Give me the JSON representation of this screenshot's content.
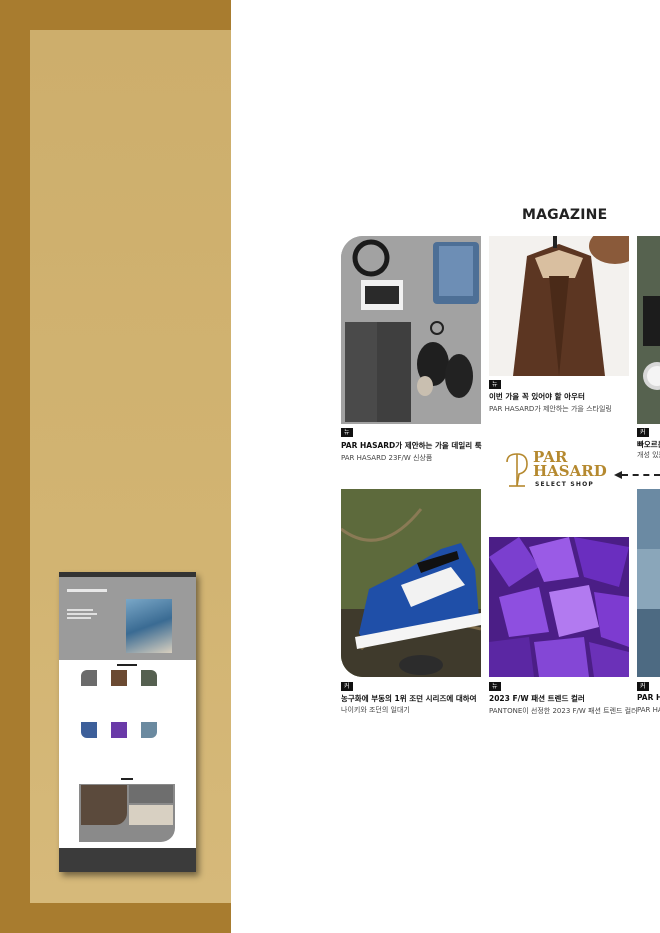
{
  "magazine": {
    "heading": "MAGAZINE",
    "cards": [
      {
        "tag": "뉴스",
        "title": "PAR HASARD가 제안하는 가을 데일리 룩",
        "subtitle": "PAR HASARD 23F/W 신상품"
      },
      {
        "tag": "뉴스",
        "title": "이번 가을 꼭 있어야 할 아우터",
        "subtitle": "PAR HASARD가 제안하는 가을 스타일링"
      },
      {
        "tag": "커버 스토",
        "title": "빠오르는",
        "subtitle": "개성 있는"
      },
      {
        "tag": "커버 스토리",
        "title": "농구화에 부동의 1위 조던 시리즈에 대하여",
        "subtitle": "나이키와 조던의 일대기"
      },
      {
        "tag": "뉴스",
        "title": "2023 F/W 패션 트렌드 컬러",
        "subtitle": "PANTONE이 선정한 2023 F/W 패션 트렌드 컬러"
      },
      {
        "tag": "커버 스",
        "title": "PAR HA",
        "subtitle": "PAR HA"
      }
    ]
  },
  "brand": {
    "line1": "PAR",
    "line2": "HASARD",
    "line3": "SELECT SHOP"
  },
  "colors": {
    "gold": "#b5892f",
    "frame": "#a87c2f",
    "frame_inner": "#d2b472"
  }
}
